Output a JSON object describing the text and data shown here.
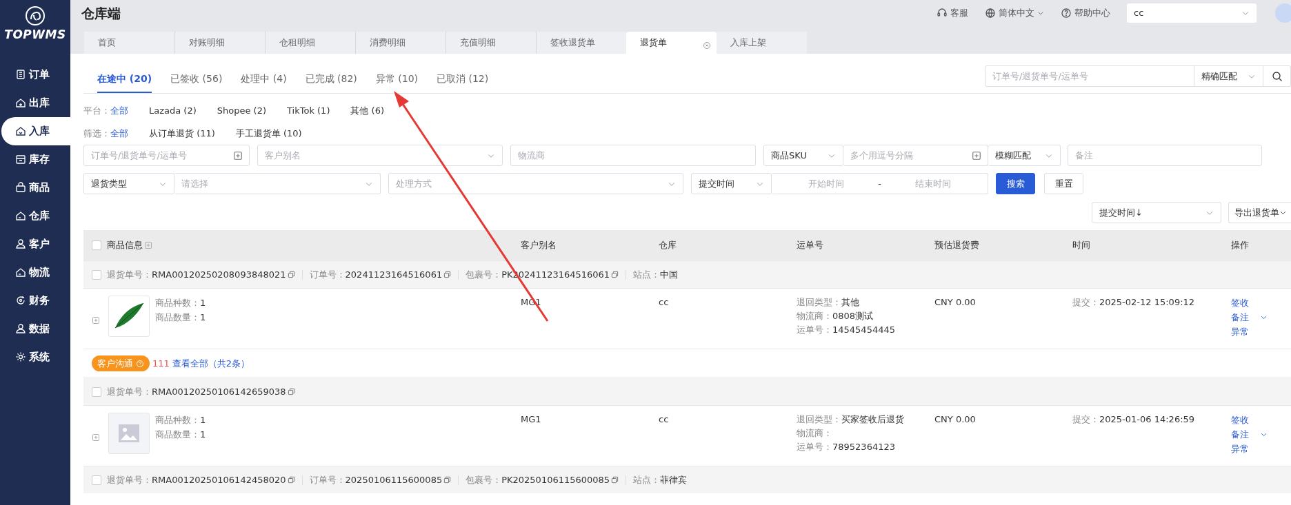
{
  "sidebar": {
    "logo": "TOPWMS",
    "items": [
      {
        "label": "订单",
        "selected": false
      },
      {
        "label": "出库",
        "selected": false
      },
      {
        "label": "入库",
        "selected": true
      },
      {
        "label": "库存",
        "selected": false
      },
      {
        "label": "商品",
        "selected": false
      },
      {
        "label": "仓库",
        "selected": false
      },
      {
        "label": "客户",
        "selected": false
      },
      {
        "label": "物流",
        "selected": false
      },
      {
        "label": "财务",
        "selected": false
      },
      {
        "label": "数据",
        "selected": false
      },
      {
        "label": "系统",
        "selected": false
      }
    ]
  },
  "header": {
    "title": "仓库端",
    "links": [
      {
        "label": "客服",
        "dropdown": false
      },
      {
        "label": "简体中文",
        "dropdown": true
      },
      {
        "label": "帮助中心",
        "dropdown": false
      }
    ],
    "account": {
      "value": "cc"
    }
  },
  "page_tabs": [
    {
      "label": "首页",
      "selected": false,
      "closable": false
    },
    {
      "label": "对账明细",
      "selected": false,
      "closable": false
    },
    {
      "label": "仓租明细",
      "selected": false,
      "closable": false
    },
    {
      "label": "消费明细",
      "selected": false,
      "closable": false
    },
    {
      "label": "充值明细",
      "selected": false,
      "closable": false
    },
    {
      "label": "签收退货单",
      "selected": false,
      "closable": false
    },
    {
      "label": "退货单",
      "selected": true,
      "closable": true
    },
    {
      "label": "入库上架",
      "selected": false,
      "closable": false
    }
  ],
  "status_tabs": [
    {
      "label": "在途中 (20)",
      "selected": true
    },
    {
      "label": "已签收 (56)",
      "selected": false
    },
    {
      "label": "处理中 (4)",
      "selected": false
    },
    {
      "label": "已完成 (82)",
      "selected": false
    },
    {
      "label": "异常 (10)",
      "selected": false
    },
    {
      "label": "已取消 (12)",
      "selected": false
    }
  ],
  "quick_search": {
    "placeholder": "订单号/退货单号/运单号",
    "match_mode": "精确匹配"
  },
  "filter_groups": [
    {
      "label": "平台：",
      "options": [
        {
          "label": "全部",
          "selected": true
        },
        {
          "label": "Lazada (2)",
          "selected": false
        },
        {
          "label": "Shopee (2)",
          "selected": false
        },
        {
          "label": "TikTok (1)",
          "selected": false
        },
        {
          "label": "其他 (6)",
          "selected": false
        }
      ]
    },
    {
      "label": "筛选：",
      "options": [
        {
          "label": "全部",
          "selected": true
        },
        {
          "label": "从订单退货 (11)",
          "selected": false
        },
        {
          "label": "手工退货单 (10)",
          "selected": false
        }
      ]
    }
  ],
  "filter_rows": [
    [
      {
        "kind": "text",
        "placeholder": "订单号/退货单号/运单号",
        "batch": true
      },
      {
        "kind": "select",
        "placeholder": "客户别名"
      },
      {
        "kind": "text",
        "placeholder": "物流商",
        "batch": false
      },
      {
        "kind": "select",
        "value": "商品SKU"
      },
      {
        "kind": "text",
        "placeholder": "多个用逗号分隔",
        "batch": true
      },
      {
        "kind": "select",
        "value": "模糊匹配"
      },
      {
        "kind": "text",
        "placeholder": "备注",
        "batch": false
      }
    ],
    [
      {
        "kind": "select",
        "value": "退货类型"
      },
      {
        "kind": "select",
        "placeholder": "请选择"
      },
      {
        "kind": "select",
        "placeholder": "处理方式"
      },
      {
        "kind": "select",
        "value": "提交时间"
      },
      {
        "kind": "range",
        "start_placeholder": "开始时间",
        "separator": "-",
        "end_placeholder": "结束时间"
      },
      {
        "kind": "button",
        "label": "搜索",
        "primary": true
      },
      {
        "kind": "button",
        "label": "重置",
        "primary": false
      }
    ]
  ],
  "sort": {
    "value": "提交时间↓"
  },
  "export_button": {
    "label": "导出退货单"
  },
  "table": {
    "select_all_checked": false,
    "columns": [
      {
        "label": "商品信息"
      },
      {
        "label": "客户别名"
      },
      {
        "label": "仓库"
      },
      {
        "label": "运单号"
      },
      {
        "label": "预估退货费"
      },
      {
        "label": "时间"
      },
      {
        "label": "操作"
      }
    ],
    "orders": [
      {
        "checked": false,
        "fields": [
          {
            "label": "退货单号：",
            "value": "RMA00120250208093848021",
            "copy": true
          },
          {
            "label": "订单号：",
            "value": "20241123164516061",
            "copy": true
          },
          {
            "label": "包裹号：",
            "value": "PK20241123164516061",
            "copy": true
          },
          {
            "label": "站点：",
            "value": "中国",
            "copy": false
          }
        ],
        "product": {
          "kind": "photo",
          "kinds_label": "商品种数：",
          "kinds": "1",
          "qty_label": "商品数量：",
          "qty": "1"
        },
        "customer": "MG1",
        "warehouse": "cc",
        "shipping": [
          {
            "label": "退回类型：",
            "value": "其他"
          },
          {
            "label": "物流商：",
            "value": "0808测试"
          },
          {
            "label": "运单号：",
            "value": "14545454445"
          }
        ],
        "fee": "CNY 0.00",
        "time_label": "提交：",
        "time": "2025-02-12 15:09:12",
        "actions": [
          {
            "label": "签收",
            "menu": false
          },
          {
            "label": "备注",
            "menu": true
          },
          {
            "label": "异常",
            "menu": false
          }
        ],
        "communication": {
          "tag": "客户沟通",
          "count": "111",
          "link": "查看全部（共2条）"
        }
      },
      {
        "checked": false,
        "fields": [
          {
            "label": "退货单号：",
            "value": "RMA00120250106142659038",
            "copy": true
          }
        ],
        "product": {
          "kind": "empty",
          "kinds_label": "商品种数：",
          "kinds": "1",
          "qty_label": "商品数量：",
          "qty": "1"
        },
        "customer": "MG1",
        "warehouse": "cc",
        "shipping": [
          {
            "label": "退回类型：",
            "value": "买家签收后退货"
          },
          {
            "label": "物流商："
          },
          {
            "label": "运单号：",
            "value": "78952364123"
          }
        ],
        "fee": "CNY 0.00",
        "time_label": "提交：",
        "time": "2025-01-06 14:26:59",
        "actions": [
          {
            "label": "签收",
            "menu": false
          },
          {
            "label": "备注",
            "menu": true
          },
          {
            "label": "异常",
            "menu": false
          }
        ]
      },
      {
        "checked": false,
        "fields": [
          {
            "label": "退货单号：",
            "value": "RMA00120250106142458020",
            "copy": true
          },
          {
            "label": "订单号：",
            "value": "20250106115600085",
            "copy": true
          },
          {
            "label": "包裹号：",
            "value": "PK20250106115600085",
            "copy": true
          },
          {
            "label": "站点：",
            "value": "菲律宾",
            "copy": false
          }
        ]
      }
    ]
  }
}
